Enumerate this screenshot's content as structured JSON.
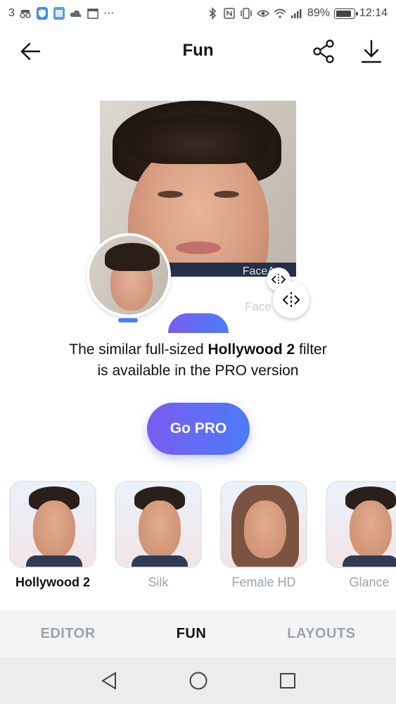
{
  "status_bar": {
    "notification_count": "3",
    "battery_percent": "89%",
    "time": "12:14",
    "more_indicator": "···"
  },
  "header": {
    "title": "Fun",
    "back_icon": "arrow-left-icon",
    "share_icon": "share-icon",
    "download_icon": "download-icon"
  },
  "preview": {
    "watermark_1": "FaceA",
    "watermark_2": "Face"
  },
  "message": {
    "line1_prefix": "The similar full-sized ",
    "filter_name": "Hollywood 2",
    "line1_suffix": " filter",
    "line2": "is available in the PRO version"
  },
  "cta": {
    "label": "Go PRO",
    "gradient_start": "#7a5cf0",
    "gradient_end": "#4c7cf8"
  },
  "filters": [
    {
      "label": "Hollywood 2",
      "active": true
    },
    {
      "label": "Silk",
      "active": false
    },
    {
      "label": "Female HD",
      "active": false
    },
    {
      "label": "Glance",
      "active": false
    }
  ],
  "tabs": [
    {
      "label": "EDITOR",
      "active": false
    },
    {
      "label": "FUN",
      "active": true
    },
    {
      "label": "LAYOUTS",
      "active": false
    }
  ],
  "nav": {
    "back_icon": "triangle-back-icon",
    "home_icon": "circle-home-icon",
    "recents_icon": "square-recents-icon"
  }
}
